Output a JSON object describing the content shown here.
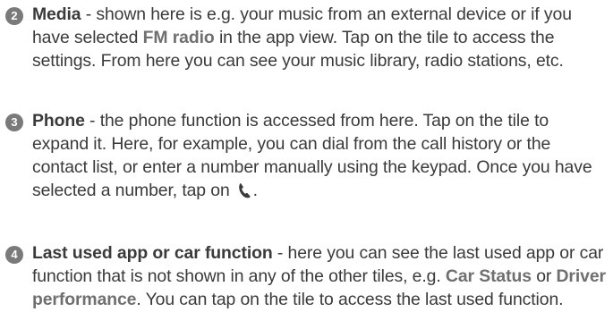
{
  "items": [
    {
      "number": "2",
      "term": "Media",
      "t1": " - shown here is e.g. your music from an external device or if you have selected ",
      "h1": "FM radio",
      "t2": " in the app view. Tap on the tile to access the settings. From here you can see your music library, radio stations, etc."
    },
    {
      "number": "3",
      "term": "Phone",
      "t1": " - the phone function is accessed from here. Tap on the tile to expand it. Here, for example, you can dial from the call history or the contact list, or enter a number manually using the keypad. Once you have selected a number, tap on",
      "icon": "phone-handset-icon",
      "t2": "."
    },
    {
      "number": "4",
      "term": "Last used app or car function",
      "t1": " - here you can see the last used app or car function that is not shown in any of the other tiles, e.g. ",
      "h1": "Car Status",
      "t2": " or ",
      "h2": "Driver performance",
      "t3": ". You can tap on the tile to access the last used function."
    }
  ],
  "colors": {
    "text": "#3a3a3a",
    "highlight": "#6f6f6f",
    "badge": "#7a7a7a"
  }
}
